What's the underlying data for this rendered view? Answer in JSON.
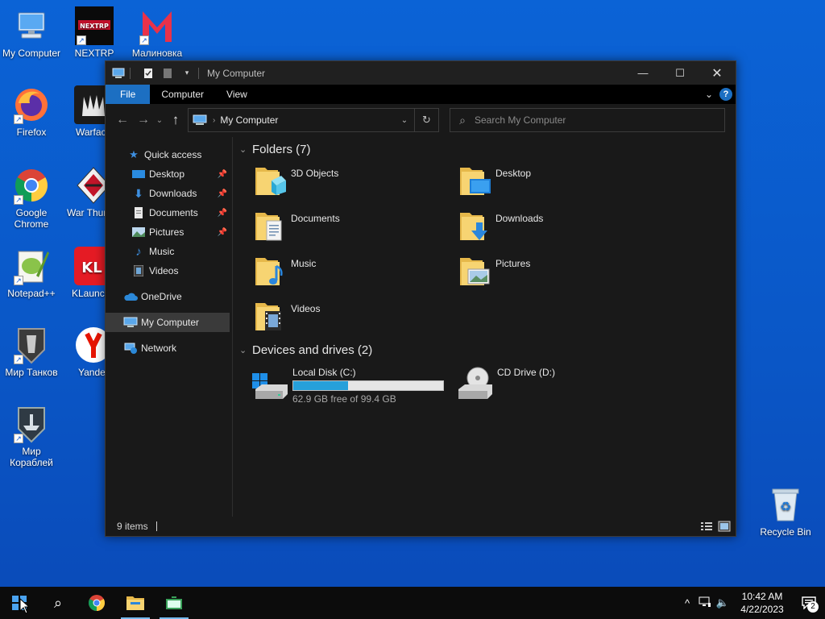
{
  "desktop": {
    "icons": [
      {
        "label": "My Computer",
        "icon": "computer-icon"
      },
      {
        "label": "NEXTRP",
        "icon": "nextrp-icon"
      },
      {
        "label": "Малиновка",
        "icon": "malinovka-icon"
      },
      {
        "label": "Firefox",
        "icon": "firefox-icon"
      },
      {
        "label": "Warfac",
        "icon": "warface-icon"
      },
      {
        "label": "Google Chrome",
        "icon": "chrome-icon"
      },
      {
        "label": "War Thun",
        "icon": "war-thunder-icon"
      },
      {
        "label": "Notepad++",
        "icon": "notepadpp-icon"
      },
      {
        "label": "KLaunch",
        "icon": "klauncher-icon"
      },
      {
        "label": "Мир Танков",
        "icon": "mir-tankov-icon"
      },
      {
        "label": "Yande",
        "icon": "yandex-icon"
      },
      {
        "label": "Мир Кораблей",
        "icon": "mir-korabley-icon"
      },
      {
        "label": "Recycle Bin",
        "icon": "recycle-bin-icon"
      }
    ]
  },
  "explorer": {
    "title": "My Computer",
    "ribbon_tabs": [
      "File",
      "Computer",
      "View"
    ],
    "address": "My Computer",
    "search_placeholder": "Search My Computer",
    "sidebar": {
      "quick_access": "Quick access",
      "items": [
        {
          "label": "Desktop",
          "pinned": true
        },
        {
          "label": "Downloads",
          "pinned": true
        },
        {
          "label": "Documents",
          "pinned": true
        },
        {
          "label": "Pictures",
          "pinned": true
        },
        {
          "label": "Music",
          "pinned": false
        },
        {
          "label": "Videos",
          "pinned": false
        }
      ],
      "onedrive": "OneDrive",
      "my_computer": "My Computer",
      "network": "Network"
    },
    "folders_header": "Folders (7)",
    "folders": [
      "3D Objects",
      "Desktop",
      "Documents",
      "Downloads",
      "Music",
      "Pictures",
      "Videos"
    ],
    "devices_header": "Devices and drives (2)",
    "drives": [
      {
        "name": "Local Disk (C:)",
        "sub": "62.9 GB free of 99.4 GB",
        "used_fraction": 0.367
      },
      {
        "name": "CD Drive (D:)"
      }
    ],
    "status": "9 items"
  },
  "taskbar": {
    "time": "10:42 AM",
    "date": "4/22/2023",
    "notification_count": "2"
  },
  "colors": {
    "accent": "#1c6fc2",
    "desktop_bg": "#0a57c7",
    "drive_bar": "#26a0da"
  }
}
